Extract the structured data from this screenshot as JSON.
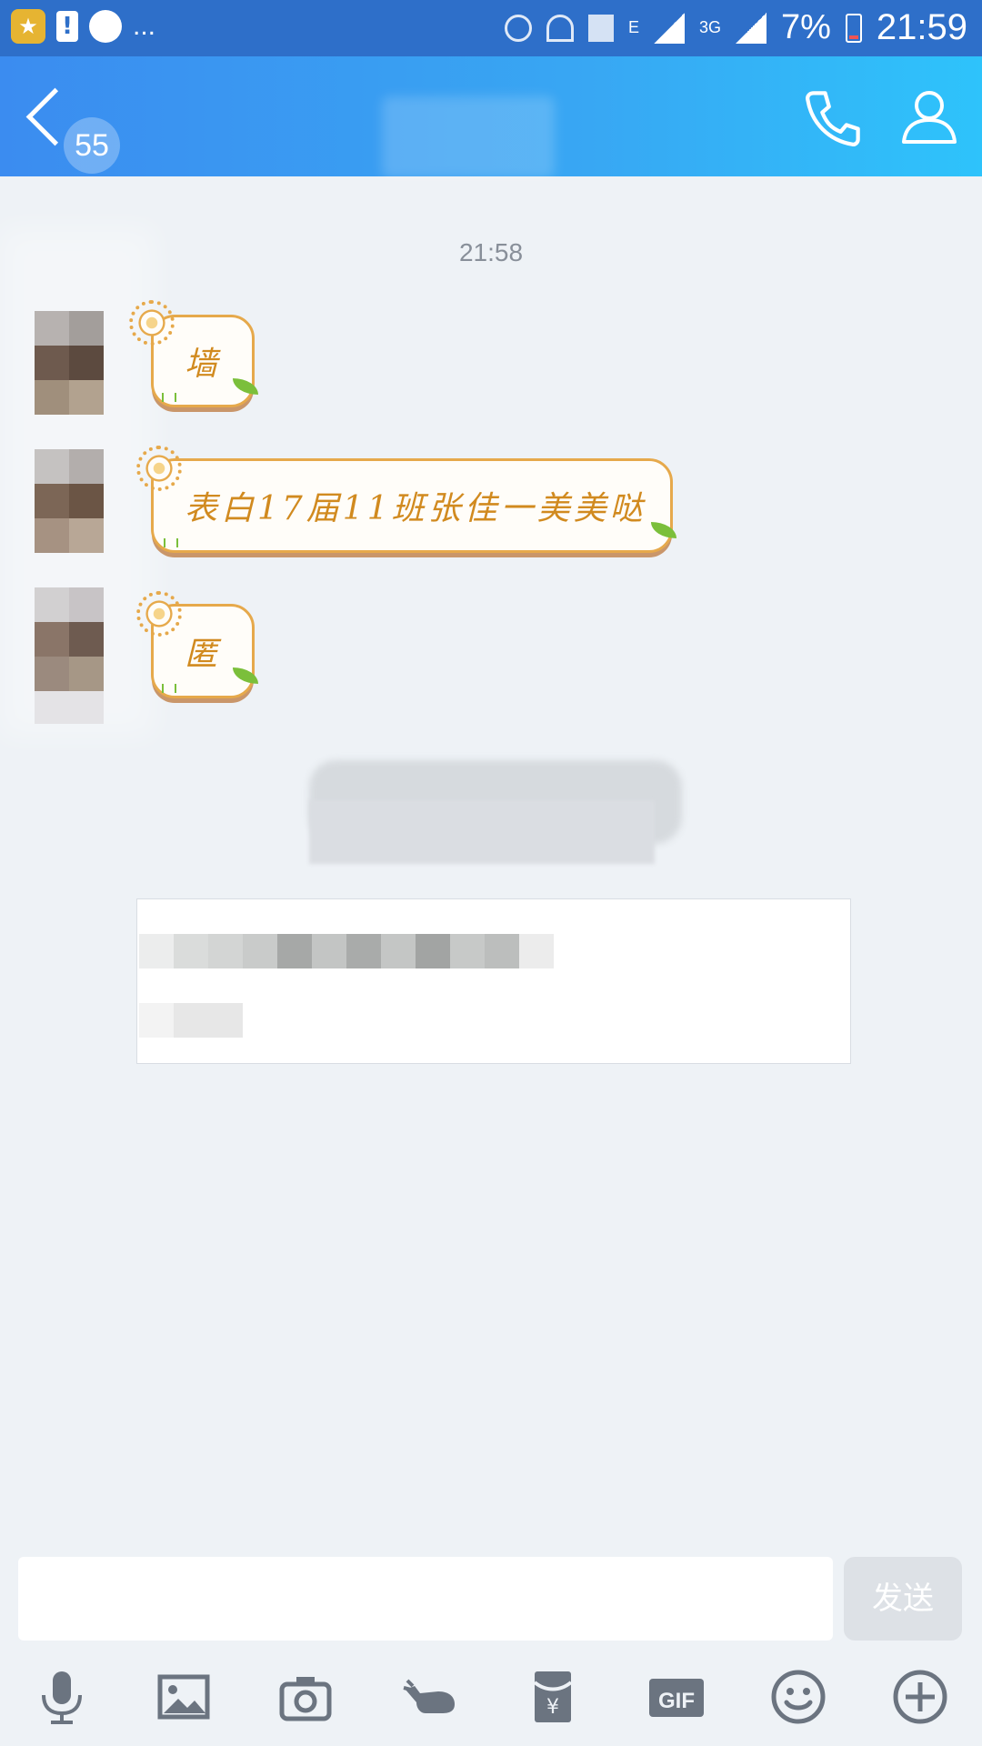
{
  "status_bar": {
    "time": "21:59",
    "battery": "7%",
    "network_3g": "3G",
    "network_e": "E",
    "overflow": "...",
    "warn_glyph": "!"
  },
  "header": {
    "unread_count": "55",
    "call_icon": "phone-icon",
    "profile_icon": "person-icon"
  },
  "chat": {
    "timestamp": "21:58",
    "messages": [
      {
        "text": "墙"
      },
      {
        "text": "表白17届11班张佳一美美哒"
      },
      {
        "text": "匿"
      }
    ]
  },
  "input_bar": {
    "placeholder": "",
    "send_label": "发送"
  },
  "toolbar": {
    "icons": [
      "microphone-icon",
      "image-icon",
      "camera-icon",
      "poke-icon",
      "red-packet-icon",
      "gif-icon",
      "emoji-icon",
      "plus-icon"
    ],
    "gif_label": "GIF"
  },
  "colors": {
    "header_gradient_start": "#3b8cf0",
    "header_gradient_end": "#2ec3fb",
    "bubble_border": "#e6a94b",
    "bubble_text": "#d18a1f",
    "background": "#eef2f6",
    "toolbar_icon": "#6b7480"
  }
}
